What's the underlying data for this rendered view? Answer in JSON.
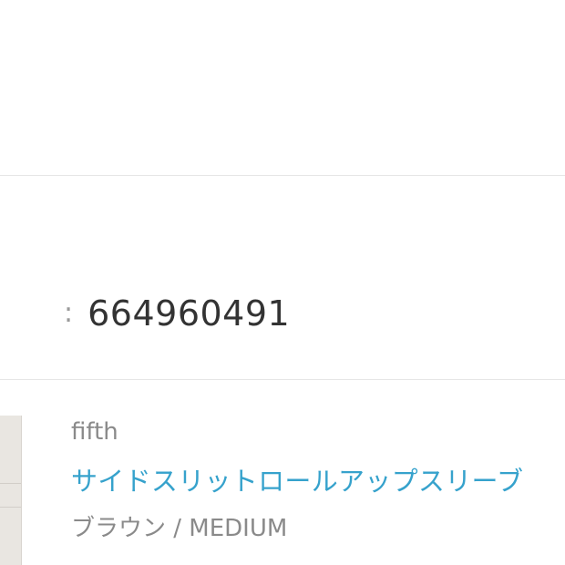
{
  "order": {
    "separator": ":",
    "number": "664960491"
  },
  "product": {
    "brand": "fifth",
    "name": "サイドスリットロールアップスリーブ",
    "variant": "ブラウン / MEDIUM"
  }
}
